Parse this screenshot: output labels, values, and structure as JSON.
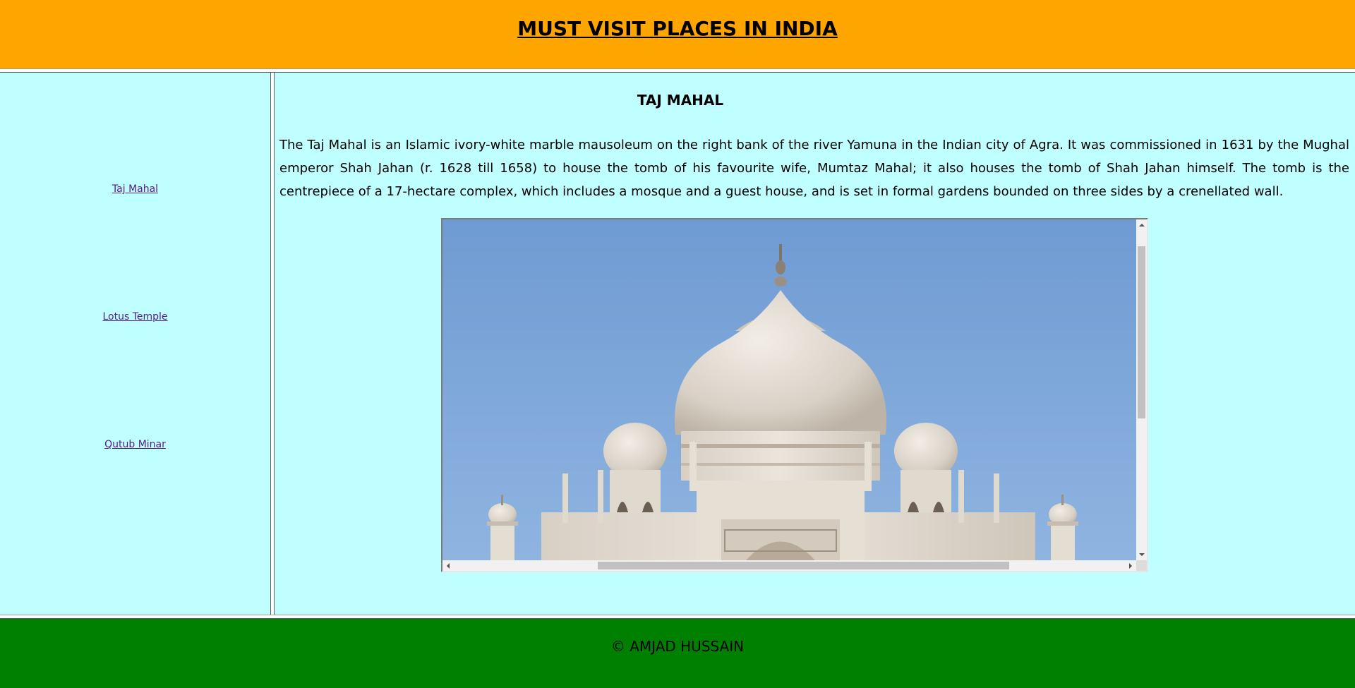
{
  "header": {
    "title": "MUST VISIT PLACES IN INDIA"
  },
  "sidebar": {
    "links": [
      {
        "label": "Taj Mahal"
      },
      {
        "label": "Lotus Temple"
      },
      {
        "label": "Qutub Minar"
      }
    ]
  },
  "main": {
    "heading": "TAJ MAHAL",
    "paragraph": "The Taj Mahal is an Islamic ivory-white marble mausoleum on the right bank of the river Yamuna in the Indian city of Agra. It was commissioned in 1631 by the Mughal emperor Shah Jahan (r. 1628 till 1658) to house the tomb of his favourite wife, Mumtaz Mahal; it also houses the tomb of Shah Jahan himself. The tomb is the centrepiece of a 17-hectare complex, which includes a mosque and a guest house, and is set in formal gardens bounded on three sides by a crenellated wall."
  },
  "footer": {
    "text": "© AMJAD HUSSAIN"
  },
  "colors": {
    "header_bg": "#ffa500",
    "content_bg": "#c0ffff",
    "footer_bg": "#008000",
    "link": "#551a8b"
  }
}
